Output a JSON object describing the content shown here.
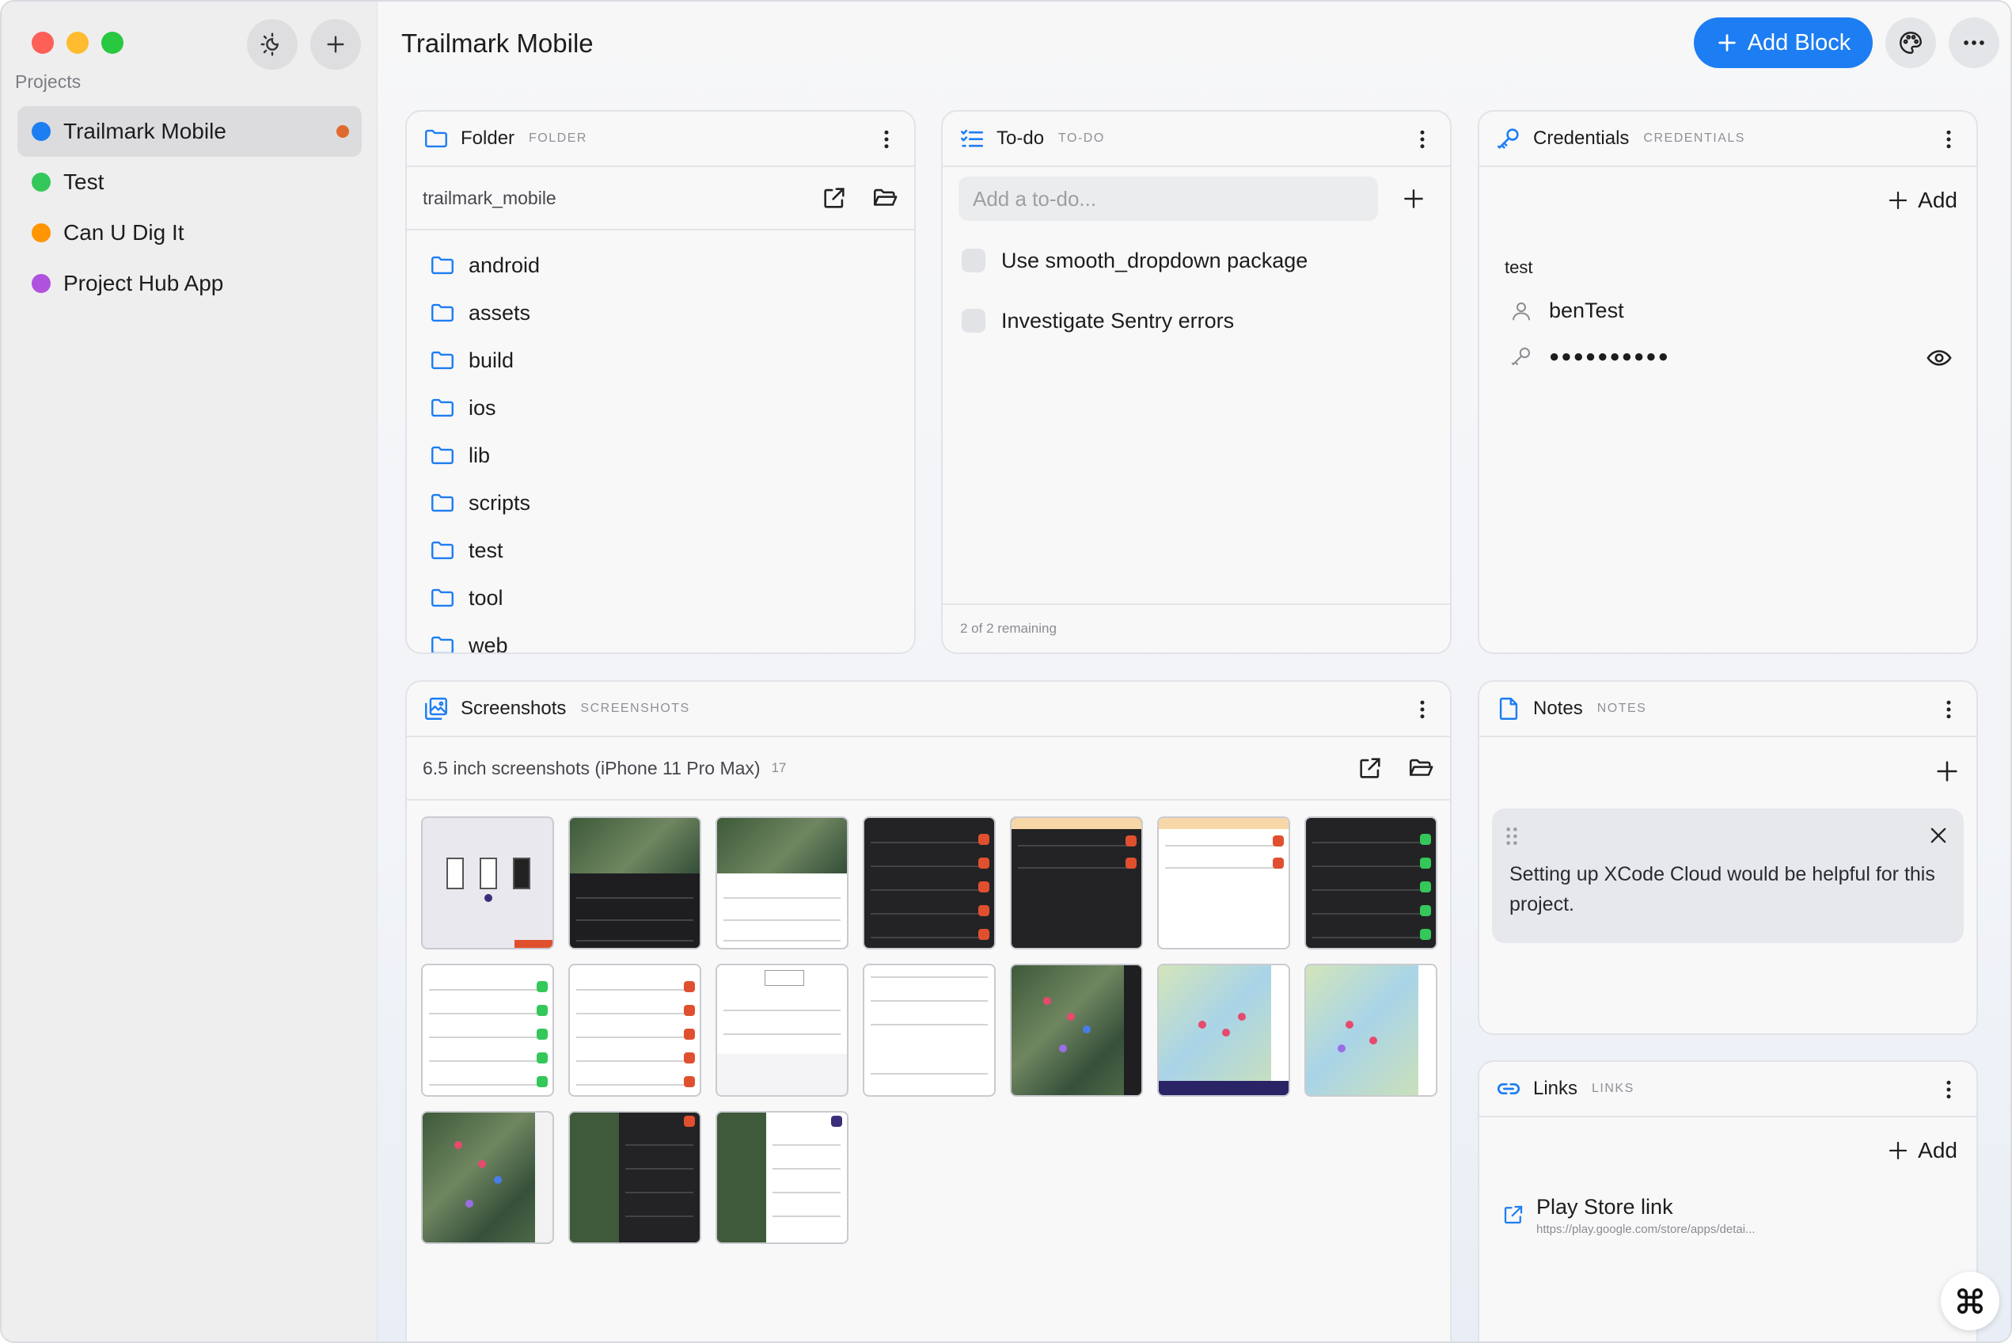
{
  "sidebar": {
    "projects_label": "Projects",
    "projects": [
      {
        "name": "Trailmark Mobile",
        "color": "#1d7df2",
        "active": true
      },
      {
        "name": "Test",
        "color": "#34c759"
      },
      {
        "name": "Can U Dig It",
        "color": "#ff9500"
      },
      {
        "name": "Project Hub App",
        "color": "#af52de"
      }
    ]
  },
  "header": {
    "title": "Trailmark Mobile",
    "add_block_label": "Add Block"
  },
  "folder": {
    "title": "Folder",
    "type": "FOLDER",
    "path": "trailmark_mobile",
    "items": [
      "android",
      "assets",
      "build",
      "ios",
      "lib",
      "scripts",
      "test",
      "tool",
      "web"
    ]
  },
  "todo": {
    "title": "To-do",
    "type": "TO-DO",
    "input_placeholder": "Add a to-do...",
    "items": [
      "Use smooth_dropdown package",
      "Investigate Sentry errors"
    ],
    "footer": "2 of 2 remaining"
  },
  "credentials": {
    "title": "Credentials",
    "type": "CREDENTIALS",
    "add_label": "Add",
    "entry_label": "test",
    "username": "benTest",
    "password_mask": "●●●●●●●●●●"
  },
  "screenshots": {
    "title": "Screenshots",
    "type": "SCREENSHOTS",
    "folder_name": "6.5 inch screenshots (iPhone 11 Pro Max)",
    "count": "17"
  },
  "notes": {
    "title": "Notes",
    "type": "NOTES",
    "note_text": "Setting up XCode Cloud would be helpful for this project."
  },
  "links": {
    "title": "Links",
    "type": "LINKS",
    "add_label": "Add",
    "items": [
      {
        "title": "Play Store link",
        "url": "https://play.google.com/store/apps/detai..."
      }
    ]
  },
  "colors": {
    "accent": "#1d7df2",
    "unsaved_dot": "#e06a2d"
  }
}
